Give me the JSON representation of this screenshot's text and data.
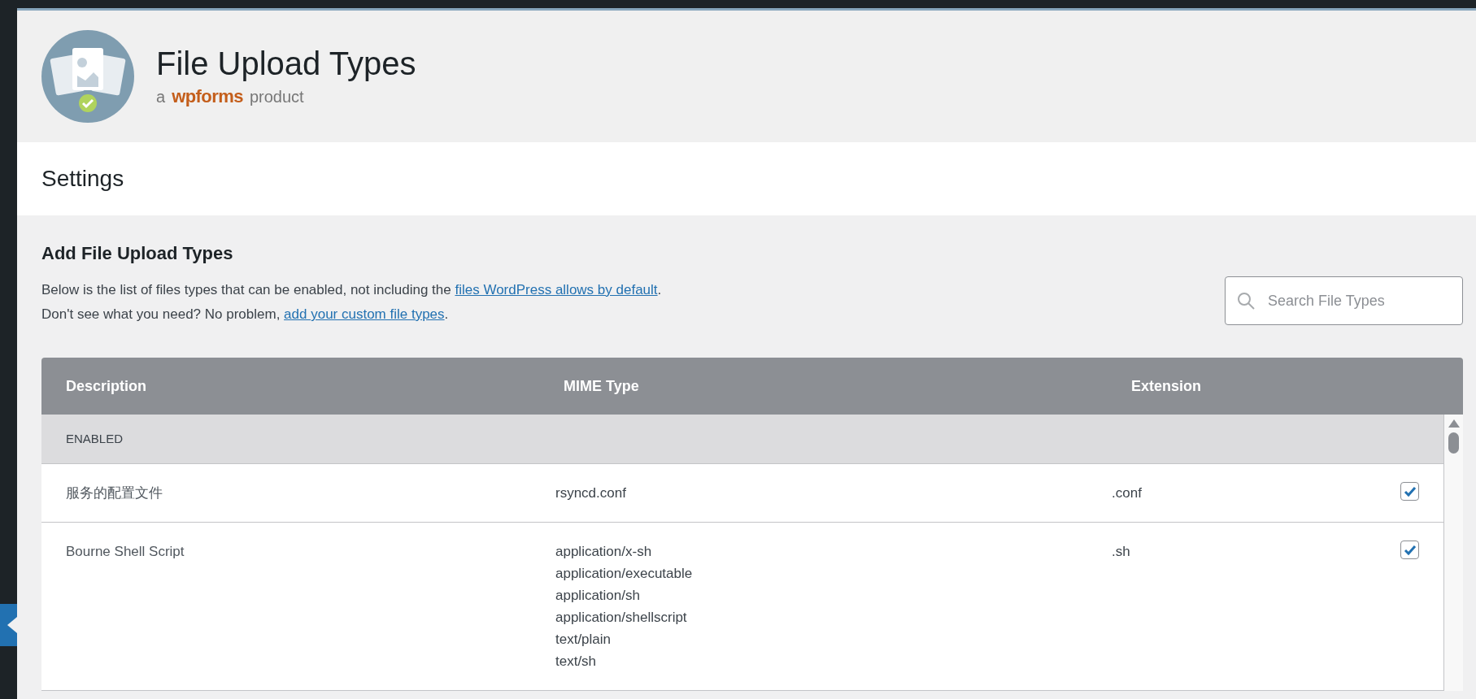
{
  "header": {
    "title": "File Upload Types",
    "subtitle_prefix": "a",
    "brand": "wpforms",
    "subtitle_suffix": "product"
  },
  "settings": {
    "title": "Settings"
  },
  "section": {
    "title": "Add File Upload Types",
    "lines": [
      [
        {
          "text": "Below is the list of files types that can be enabled, not including the "
        },
        {
          "text": "files WordPress allows by default",
          "link": true
        },
        {
          "text": "."
        }
      ],
      [
        {
          "text": "Don't see what you need? No problem, "
        },
        {
          "text": "add your custom file types",
          "link": true
        },
        {
          "text": "."
        }
      ]
    ]
  },
  "search": {
    "placeholder": "Search File Types"
  },
  "table": {
    "columns": [
      "Description",
      "MIME Type",
      "Extension"
    ],
    "group": "ENABLED",
    "rows": [
      {
        "description": "服务的配置文件",
        "mime": [
          "rsyncd.conf"
        ],
        "extension": ".conf",
        "checked": true
      },
      {
        "description": "Bourne Shell Script",
        "mime": [
          "application/x-sh",
          "application/executable",
          "application/sh",
          "application/shellscript",
          "text/plain",
          "text/sh"
        ],
        "extension": ".sh",
        "checked": true
      }
    ]
  }
}
